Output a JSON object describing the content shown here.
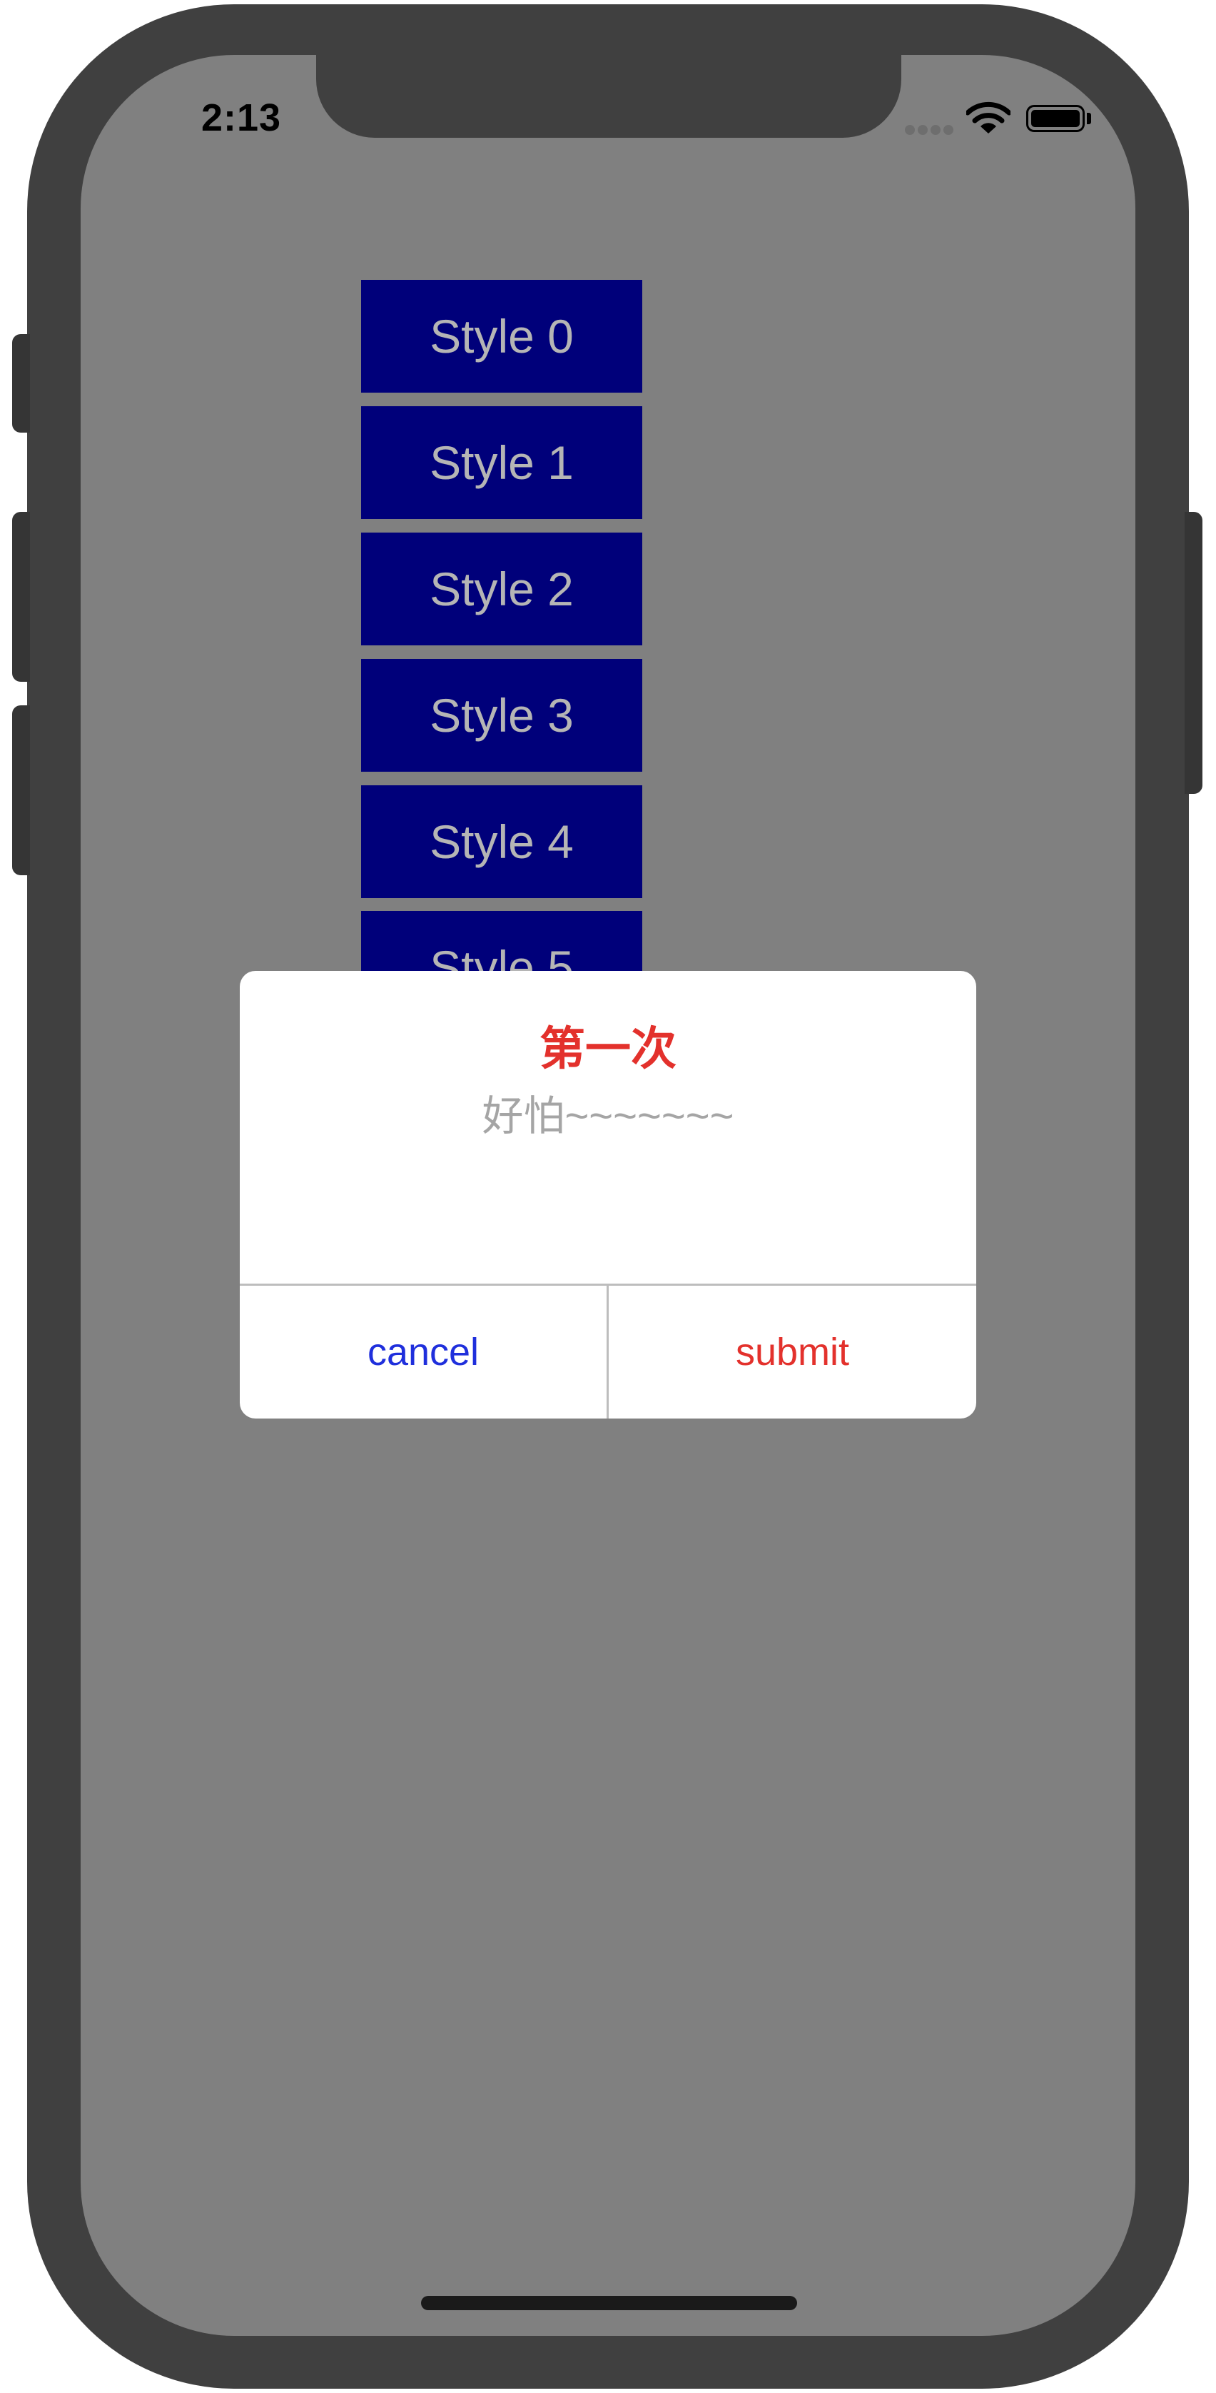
{
  "status_bar": {
    "time": "2:13",
    "icons": [
      "signal-icon",
      "wifi-icon",
      "battery-icon"
    ]
  },
  "style_buttons": [
    "Style 0",
    "Style 1",
    "Style 2",
    "Style 3",
    "Style 4",
    "Style 5"
  ],
  "dialog": {
    "title": "第一次",
    "message": "好怕~~~~~~~",
    "cancel_label": "cancel",
    "submit_label": "submit"
  },
  "colors": {
    "button_background": "#00007a",
    "button_text": "#b5b5b5",
    "dialog_title": "#e3312c",
    "dialog_message": "#a5a5a5",
    "cancel": "#1f2fdc",
    "submit": "#e3312c",
    "screen_background": "#808080"
  }
}
